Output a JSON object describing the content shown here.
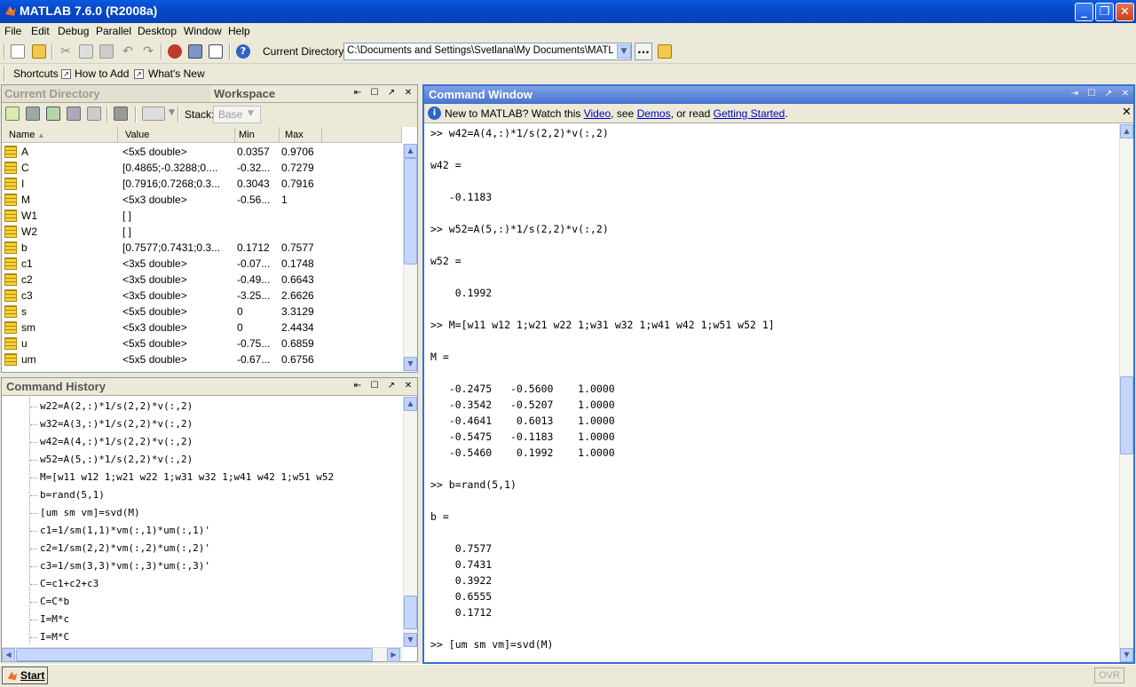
{
  "window": {
    "title": "MATLAB  7.6.0 (R2008a)"
  },
  "menu": [
    "File",
    "Edit",
    "Debug",
    "Parallel",
    "Desktop",
    "Window",
    "Help"
  ],
  "toolbar": {
    "current_dir_label": "Current Directory:",
    "current_dir_value": "C:\\Documents and Settings\\Svetlana\\My Documents\\MATLAB",
    "browse_label": "..."
  },
  "shortcuts": {
    "shortcuts_label": "Shortcuts",
    "how_to_add": "How to Add",
    "whats_new": "What's New"
  },
  "workspace": {
    "tab_current_directory": "Current Directory",
    "tab_workspace": "Workspace",
    "stack_label": "Stack:",
    "stack_value": "Base",
    "columns": [
      "Name",
      "Value",
      "Min",
      "Max"
    ],
    "rows": [
      {
        "name": "A",
        "value": "<5x5 double>",
        "min": "0.0357",
        "max": "0.9706"
      },
      {
        "name": "C",
        "value": "[0.4865;-0.3288;0....",
        "min": "-0.32...",
        "max": "0.7279"
      },
      {
        "name": "I",
        "value": "[0.7916;0.7268;0.3...",
        "min": "0.3043",
        "max": "0.7916"
      },
      {
        "name": "M",
        "value": "<5x3 double>",
        "min": "-0.56...",
        "max": "1"
      },
      {
        "name": "W1",
        "value": "[ ]",
        "min": "",
        "max": ""
      },
      {
        "name": "W2",
        "value": "[ ]",
        "min": "",
        "max": ""
      },
      {
        "name": "b",
        "value": "[0.7577;0.7431;0.3...",
        "min": "0.1712",
        "max": "0.7577"
      },
      {
        "name": "c1",
        "value": "<3x5 double>",
        "min": "-0.07...",
        "max": "0.1748"
      },
      {
        "name": "c2",
        "value": "<3x5 double>",
        "min": "-0.49...",
        "max": "0.6643"
      },
      {
        "name": "c3",
        "value": "<3x5 double>",
        "min": "-3.25...",
        "max": "2.6626"
      },
      {
        "name": "s",
        "value": "<5x5 double>",
        "min": "0",
        "max": "3.3129"
      },
      {
        "name": "sm",
        "value": "<5x3 double>",
        "min": "0",
        "max": "2.4434"
      },
      {
        "name": "u",
        "value": "<5x5 double>",
        "min": "-0.75...",
        "max": "0.6859"
      },
      {
        "name": "um",
        "value": "<5x5 double>",
        "min": "-0.67...",
        "max": "0.6756"
      }
    ]
  },
  "history": {
    "title": "Command History",
    "lines": [
      "w22=A(2,:)*1/s(2,2)*v(:,2)",
      "w32=A(3,:)*1/s(2,2)*v(:,2)",
      "w42=A(4,:)*1/s(2,2)*v(:,2)",
      "w52=A(5,:)*1/s(2,2)*v(:,2)",
      "M=[w11 w12 1;w21 w22 1;w31 w32 1;w41 w42 1;w51 w52",
      "b=rand(5,1)",
      "[um sm vm]=svd(M)",
      "c1=1/sm(1,1)*vm(:,1)*um(:,1)'",
      "c2=1/sm(2,2)*vm(:,2)*um(:,2)'",
      "c3=1/sm(3,3)*vm(:,3)*um(:,3)'",
      "C=c1+c2+c3",
      "C=C*b",
      "I=M*c",
      "I=M*C"
    ]
  },
  "command_window": {
    "title": "Command Window",
    "info_pre": "New to MATLAB? Watch this ",
    "info_video": "Video",
    "info_mid": ", see ",
    "info_demos": "Demos",
    "info_mid2": ", or read ",
    "info_getting_started": "Getting Started",
    "info_end": ".",
    "lines": [
      ">> w42=A(4,:)*1/s(2,2)*v(:,2)",
      "",
      "w42 =",
      "",
      "   -0.1183",
      "",
      ">> w52=A(5,:)*1/s(2,2)*v(:,2)",
      "",
      "w52 =",
      "",
      "    0.1992",
      "",
      ">> M=[w11 w12 1;w21 w22 1;w31 w32 1;w41 w42 1;w51 w52 1]",
      "",
      "M =",
      "",
      "   -0.2475   -0.5600    1.0000",
      "   -0.3542   -0.5207    1.0000",
      "   -0.4641    0.6013    1.0000",
      "   -0.5475   -0.1183    1.0000",
      "   -0.5460    0.1992    1.0000",
      "",
      ">> b=rand(5,1)",
      "",
      "b =",
      "",
      "    0.7577",
      "    0.7431",
      "    0.3922",
      "    0.6555",
      "    0.1712",
      "",
      ">> [um sm vm]=svd(M)"
    ]
  },
  "taskbar": {
    "start_label": "Start",
    "ovr_label": "OVR"
  }
}
